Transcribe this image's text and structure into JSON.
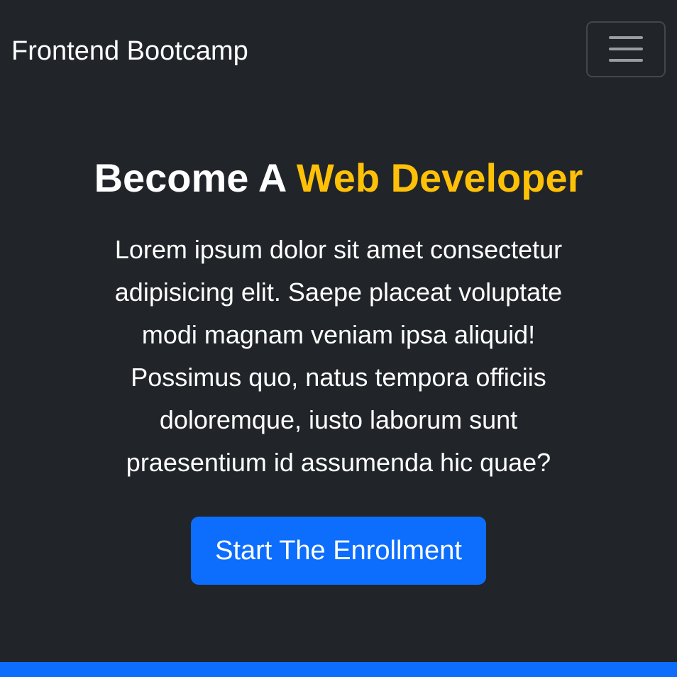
{
  "navbar": {
    "brand": "Frontend Bootcamp",
    "toggler_icon": "hamburger-menu-icon"
  },
  "hero": {
    "headline_plain": "Become A ",
    "headline_accent": "Web Developer",
    "lead": "Lorem ipsum dolor sit amet consectetur adipisicing elit. Saepe placeat voluptate modi magnam veniam ipsa aliquid! Possimus quo, natus tempora officiis doloremque, iusto laborum sunt praesentium id assumenda hic quae?",
    "cta_label": "Start The Enrollment"
  },
  "colors": {
    "background": "#212529",
    "accent": "#ffc107",
    "primary": "#0d6efd",
    "text": "#ffffff"
  }
}
